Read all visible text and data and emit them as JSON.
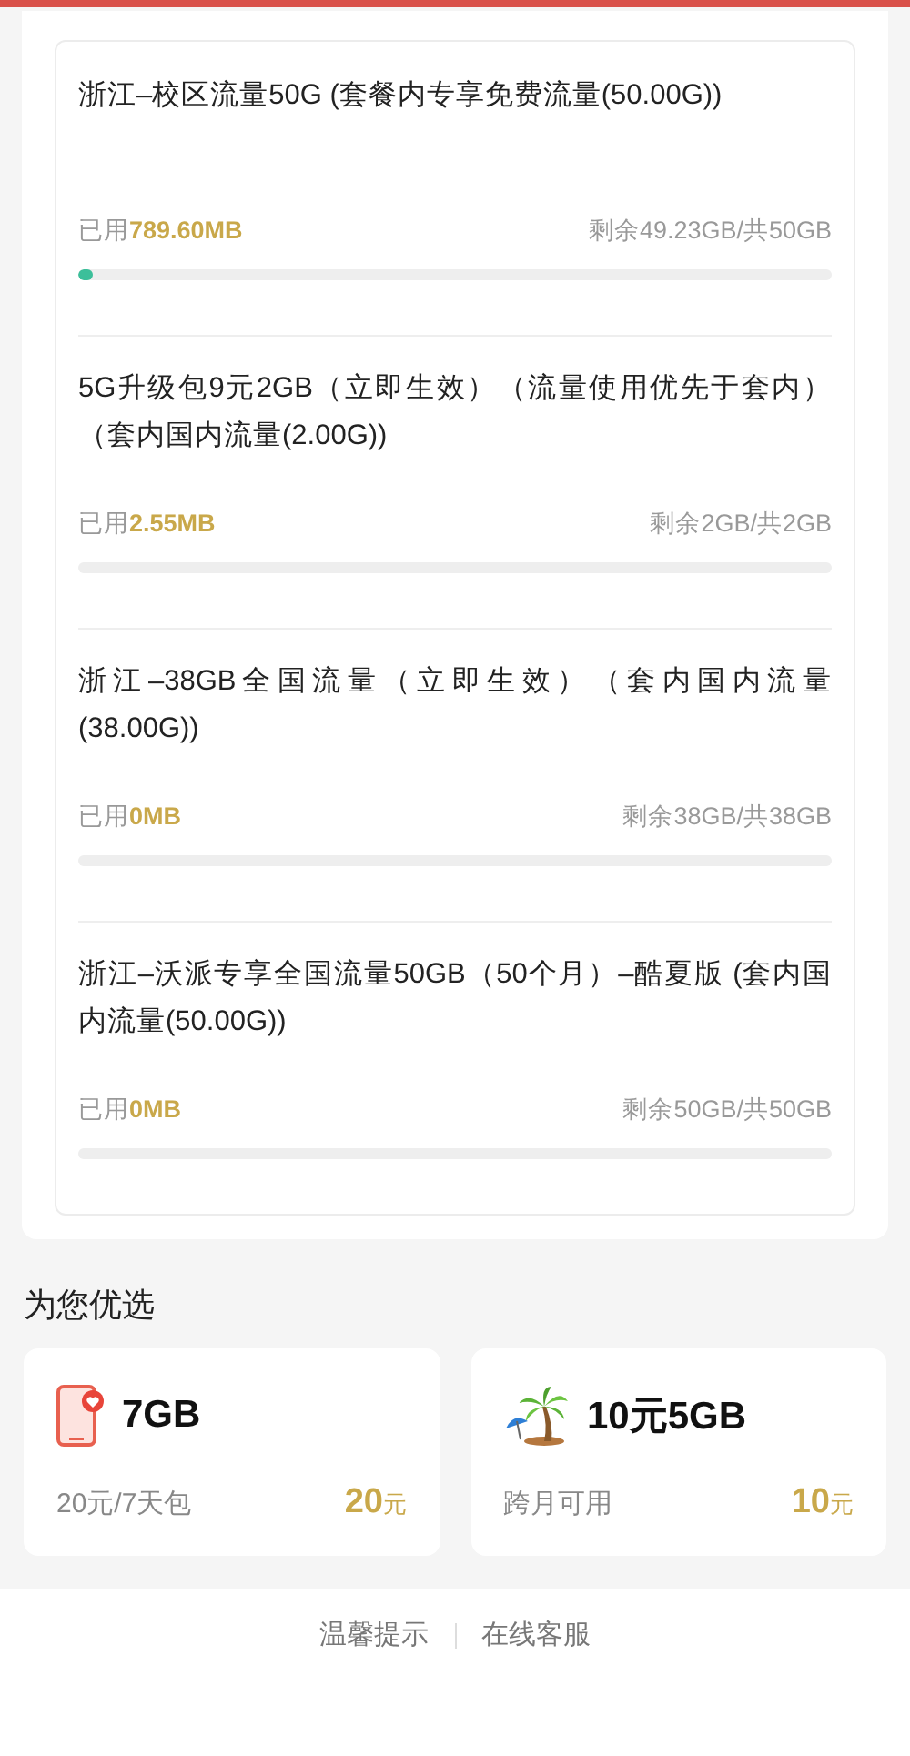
{
  "packages": [
    {
      "title": "浙江–校区流量50G (套餐内专享免费流量(50.00G))",
      "used_label": "已用",
      "used_value": "789.60MB",
      "remaining": "剩余49.23GB/共50GB",
      "level": 0.02
    },
    {
      "title": "5G升级包9元2GB（立即生效）（流量使用优先于套内）（套内国内流量(2.00G))",
      "used_label": "已用",
      "used_value": "2.55MB",
      "remaining": "剩余2GB/共2GB"
    },
    {
      "title": "浙江–38GB全国流量（立即生效）（套内国内流量(38.00G))",
      "used_label": "已用",
      "used_value": "0MB",
      "remaining": "剩余38GB/共38GB"
    },
    {
      "title": "浙江–沃派专享全国流量50GB（50个月）–酷夏版 (套内国内流量(50.00G))",
      "used_label": "已用",
      "used_value": "0MB",
      "remaining": "剩余50GB/共50GB"
    }
  ],
  "recommend": {
    "heading": "为您优选",
    "offers": [
      {
        "kind": "phone",
        "name": "7GB",
        "desc": "20元/7天包",
        "price": "20",
        "unit": "元"
      },
      {
        "kind": "palm",
        "name": "10元5GB",
        "desc": "跨月可用",
        "price": "10",
        "unit": "元"
      }
    ]
  },
  "footer": {
    "links": [
      "温馨提示",
      "在线客服"
    ]
  }
}
